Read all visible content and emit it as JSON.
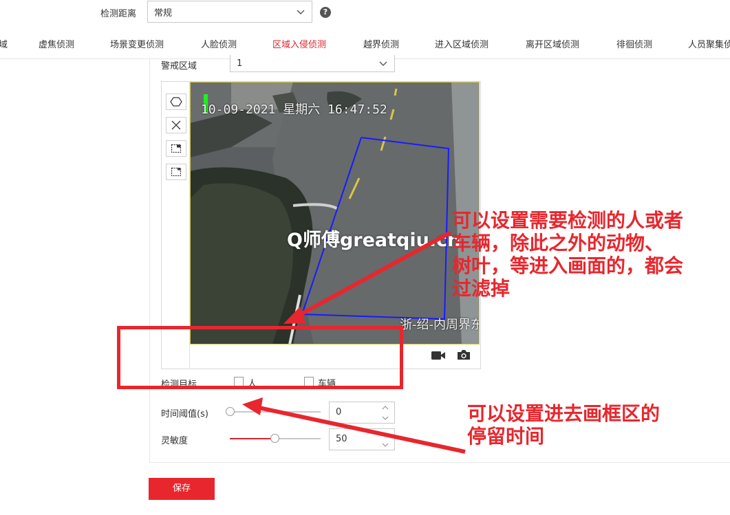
{
  "detection_distance": {
    "label": "检测距离",
    "value": "常规"
  },
  "help_glyph": "?",
  "tabs": [
    {
      "label": "域"
    },
    {
      "label": "虚焦侦测"
    },
    {
      "label": "场景变更侦测"
    },
    {
      "label": "人脸侦测"
    },
    {
      "label": "区域入侵侦测"
    },
    {
      "label": "越界侦测"
    },
    {
      "label": "进入区域侦测"
    },
    {
      "label": "离开区域侦测"
    },
    {
      "label": "徘徊侦测"
    },
    {
      "label": "人员聚集侦"
    }
  ],
  "active_tab_index": 4,
  "alert_zone": {
    "label": "警戒区域",
    "value": "1"
  },
  "video": {
    "osd_timestamp": "10-09-2021 星期六 16:47:52",
    "osd_channel": "浙-绍-内周界东"
  },
  "detection_target": {
    "label": "检测目标",
    "options": [
      {
        "label": "人",
        "checked": false
      },
      {
        "label": "车辆",
        "checked": false
      }
    ]
  },
  "time_threshold": {
    "label": "时间阈值(s)",
    "value": "0",
    "fraction": 0.0
  },
  "sensitivity": {
    "label": "灵敏度",
    "value": "50",
    "fraction": 0.5
  },
  "save_label": "保存",
  "watermark": "Q师傅greatqiu.cn",
  "annotations": {
    "target_note": [
      "可以设置需要检测的人或者",
      "车辆，除此之外的动物、",
      "树叶，等进入画面的，都会",
      "过滤掉"
    ],
    "time_note": [
      "可以设置进去画框区的",
      "停留时间"
    ]
  },
  "colors": {
    "accent": "#d9232d",
    "annotation": "#e8262d",
    "zone_line": "#1a1aff"
  }
}
